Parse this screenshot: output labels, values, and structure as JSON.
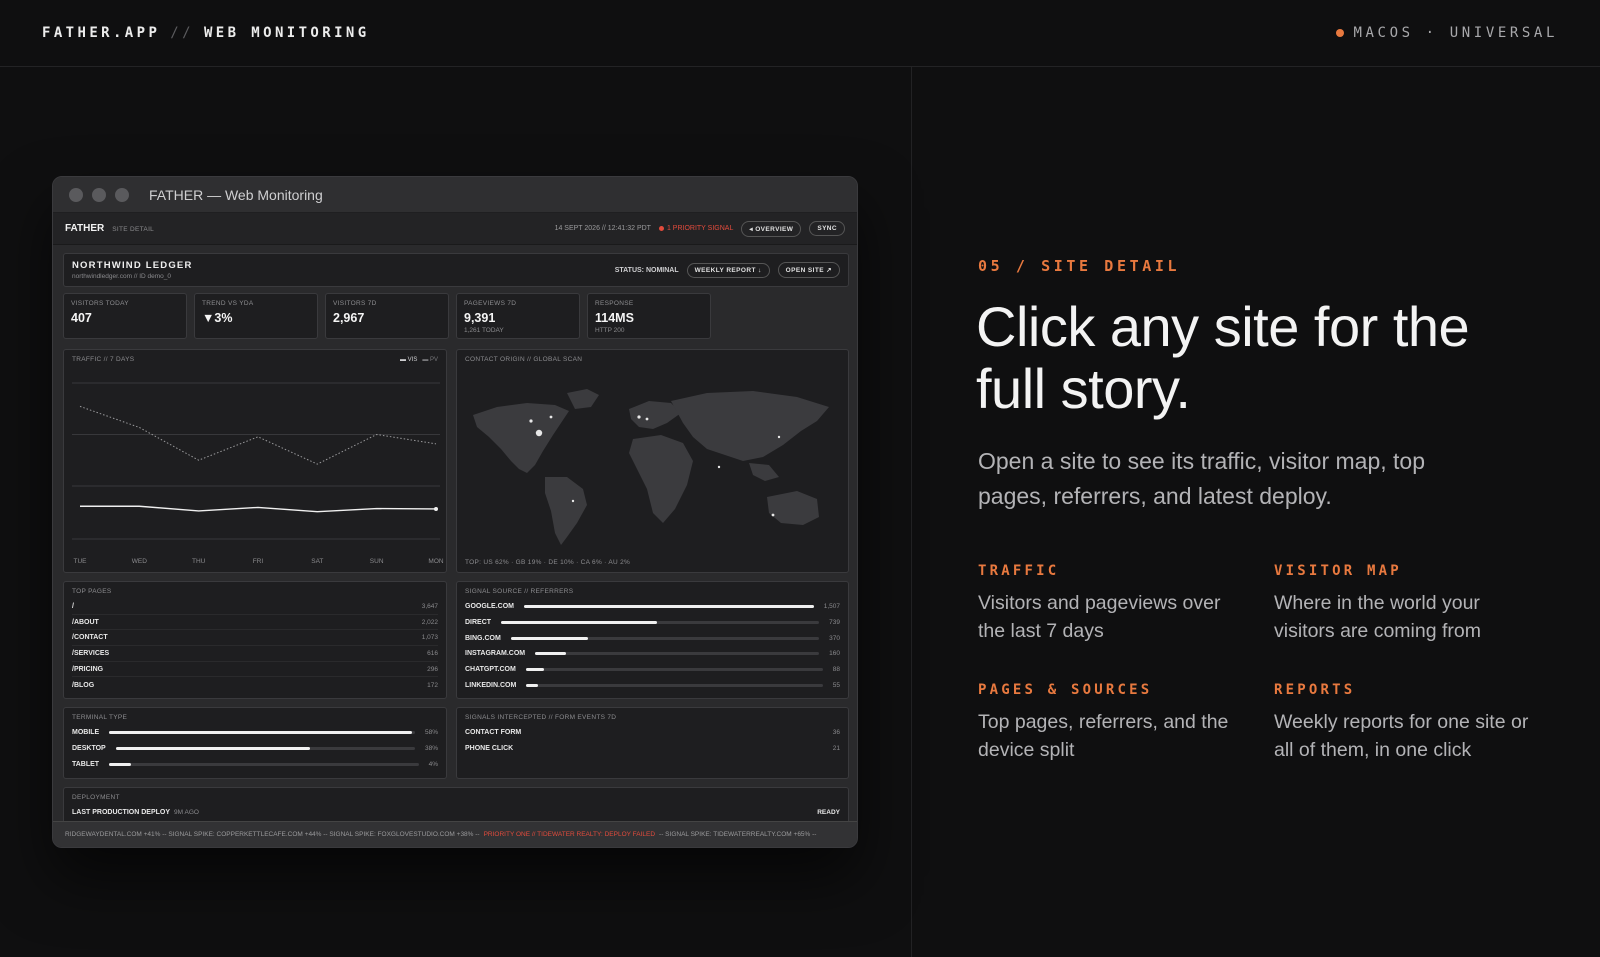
{
  "header": {
    "brand": "FATHER.APP",
    "separator": "//",
    "section": "WEB MONITORING",
    "platform": "MACOS · UNIVERSAL",
    "accent_color": "#e8793f"
  },
  "window": {
    "title": "FATHER — Web Monitoring",
    "app_brand": "FATHER",
    "crumb": "SITE DETAIL",
    "timestamp": "14 SEPT 2026 // 12:41:32 PDT",
    "priority": "1 PRIORITY SIGNAL",
    "overview_button": "◂ OVERVIEW",
    "sync_button": "SYNC"
  },
  "site": {
    "name": "NORTHWIND LEDGER",
    "sub": "northwindledger.com // ID demo_0",
    "status": "STATUS: NOMINAL",
    "weekly_report_button": "WEEKLY REPORT ↓",
    "open_site_button": "OPEN SITE ↗"
  },
  "kpis": [
    {
      "label": "VISITORS TODAY",
      "value": "407",
      "sub": ""
    },
    {
      "label": "TREND VS YDA",
      "value": "▼3%",
      "sub": ""
    },
    {
      "label": "VISITORS 7D",
      "value": "2,967",
      "sub": ""
    },
    {
      "label": "PAGEVIEWS 7D",
      "value": "9,391",
      "sub": "1,261 TODAY"
    },
    {
      "label": "RESPONSE",
      "value": "114MS",
      "sub": "HTTP 200"
    }
  ],
  "traffic": {
    "label": "TRAFFIC // 7 DAYS",
    "legend_vis": "▬ VIS",
    "legend_pv": "▬ PV"
  },
  "chart_data": {
    "type": "line",
    "x": [
      "TUE",
      "WED",
      "THU",
      "FRI",
      "SAT",
      "SUN",
      "MON"
    ],
    "series": [
      {
        "name": "PV",
        "values": [
          1700,
          1430,
          1010,
          1310,
          960,
          1340,
          1220
        ],
        "style": "dotted"
      },
      {
        "name": "VIS",
        "values": [
          420,
          420,
          360,
          405,
          350,
          390,
          385
        ],
        "style": "solid"
      }
    ],
    "ylim": [
      0,
      2000
    ],
    "grid": true
  },
  "map": {
    "label": "CONTACT ORIGIN // GLOBAL SCAN",
    "footer": "TOP: US 62% · GB 19% · DE 10% · CA 6% · AU 2%"
  },
  "top_pages": {
    "label": "TOP PAGES",
    "rows": [
      {
        "path": "/",
        "count": "3,647"
      },
      {
        "path": "/ABOUT",
        "count": "2,022"
      },
      {
        "path": "/CONTACT",
        "count": "1,073"
      },
      {
        "path": "/SERVICES",
        "count": "616"
      },
      {
        "path": "/PRICING",
        "count": "296"
      },
      {
        "path": "/BLOG",
        "count": "172"
      }
    ]
  },
  "referrers": {
    "label": "SIGNAL SOURCE // REFERRERS",
    "rows": [
      {
        "name": "GOOGLE.COM",
        "count": "1,507",
        "share": 1.0
      },
      {
        "name": "DIRECT",
        "count": "739",
        "share": 0.49
      },
      {
        "name": "BING.COM",
        "count": "370",
        "share": 0.25
      },
      {
        "name": "INSTAGRAM.COM",
        "count": "160",
        "share": 0.11
      },
      {
        "name": "CHATGPT.COM",
        "count": "88",
        "share": 0.06
      },
      {
        "name": "LINKEDIN.COM",
        "count": "55",
        "share": 0.04
      }
    ]
  },
  "terminal": {
    "label": "TERMINAL TYPE",
    "rows": [
      {
        "name": "MOBILE",
        "pct": "58%",
        "share": 0.99
      },
      {
        "name": "DESKTOP",
        "pct": "38%",
        "share": 0.65
      },
      {
        "name": "TABLET",
        "pct": "4%",
        "share": 0.07
      }
    ]
  },
  "signals": {
    "label": "SIGNALS INTERCEPTED // FORM EVENTS 7D",
    "rows": [
      {
        "name": "CONTACT FORM",
        "count": "36"
      },
      {
        "name": "PHONE CLICK",
        "count": "21"
      }
    ]
  },
  "deployment": {
    "label": "DEPLOYMENT",
    "last": "LAST PRODUCTION DEPLOY",
    "ago": "9M AGO",
    "status": "READY"
  },
  "ticker": {
    "before": "RIDGEWAYDENTAL.COM +41% -- SIGNAL SPIKE: COPPERKETTLECAFE.COM +44% -- SIGNAL SPIKE: FOXGLOVESTUDIO.COM +38% --",
    "alert": "PRIORITY ONE // TIDEWATER REALTY: DEPLOY FAILED",
    "after": "-- SIGNAL SPIKE: TIDEWATERREALTY.COM +65% --"
  },
  "hero": {
    "eyebrow": "05 / SITE DETAIL",
    "headline": "Click any site for the full story.",
    "lead": "Open a site to see its traffic, visitor map, top pages, referrers, and latest deploy."
  },
  "features": [
    {
      "title": "TRAFFIC",
      "body": "Visitors and pageviews over the last 7 days"
    },
    {
      "title": "VISITOR MAP",
      "body": "Where in the world your visitors are coming from"
    },
    {
      "title": "PAGES & SOURCES",
      "body": "Top pages, referrers, and the device split"
    },
    {
      "title": "REPORTS",
      "body": "Weekly reports for one site or all of them, in one click"
    }
  ]
}
